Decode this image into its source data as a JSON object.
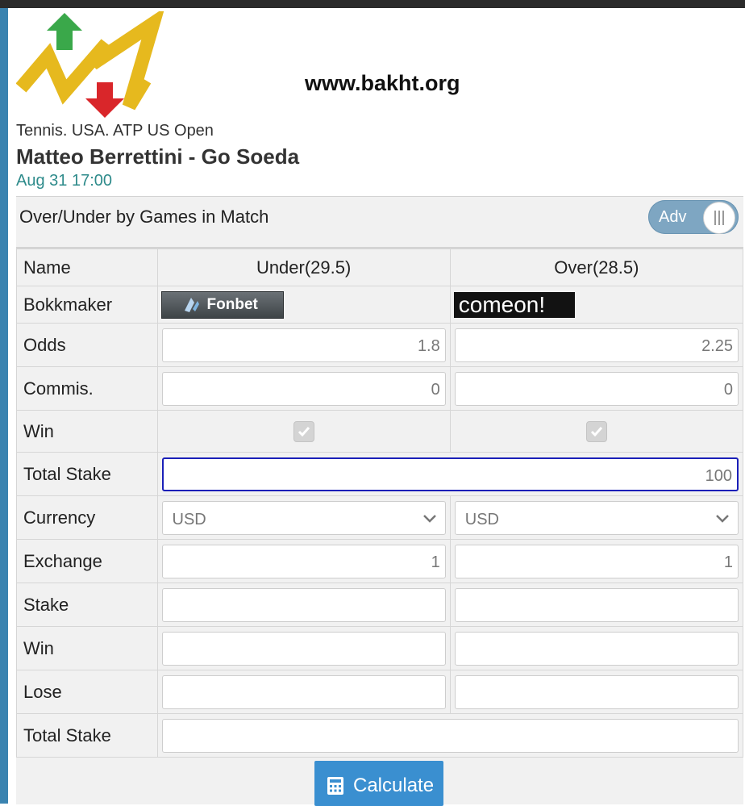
{
  "site": "www.bakht.org",
  "event": "Tennis. USA. ATP US Open",
  "match": "Matteo Berrettini - Go Soeda",
  "datetime": "Aug 31 17:00",
  "market": {
    "title": "Over/Under by Games in Match",
    "toggle_label": "Adv"
  },
  "columns": {
    "name_label": "Name",
    "col1": "Under(29.5)",
    "col2": "Over(28.5)"
  },
  "rows": {
    "bookmaker": {
      "label": "Bokkmaker",
      "col1": "Fonbet",
      "col2": "comeon!"
    },
    "odds": {
      "label": "Odds",
      "col1": "1.8",
      "col2": "2.25"
    },
    "commis": {
      "label": "Commis.",
      "col1": "0",
      "col2": "0"
    },
    "win_check": {
      "label": "Win",
      "col1_checked": true,
      "col2_checked": true
    },
    "total_stake_in": {
      "label": "Total Stake",
      "value": "100"
    },
    "currency": {
      "label": "Currency",
      "col1": "USD",
      "col2": "USD"
    },
    "exchange": {
      "label": "Exchange",
      "col1": "1",
      "col2": "1"
    },
    "stake": {
      "label": "Stake",
      "col1": "",
      "col2": ""
    },
    "win": {
      "label": "Win",
      "col1": "",
      "col2": ""
    },
    "lose": {
      "label": "Lose",
      "col1": "",
      "col2": ""
    },
    "total_stake_out": {
      "label": "Total Stake",
      "value": ""
    }
  },
  "calculate_label": "Calculate",
  "colors": {
    "accent": "#3a8fd0",
    "date": "#2e8b8b",
    "toggle": "#7ea6c2",
    "active_border": "#1a1fb8",
    "logo_up": "#3aa84a",
    "logo_down": "#d9262a",
    "logo_line": "#e6b91e"
  }
}
